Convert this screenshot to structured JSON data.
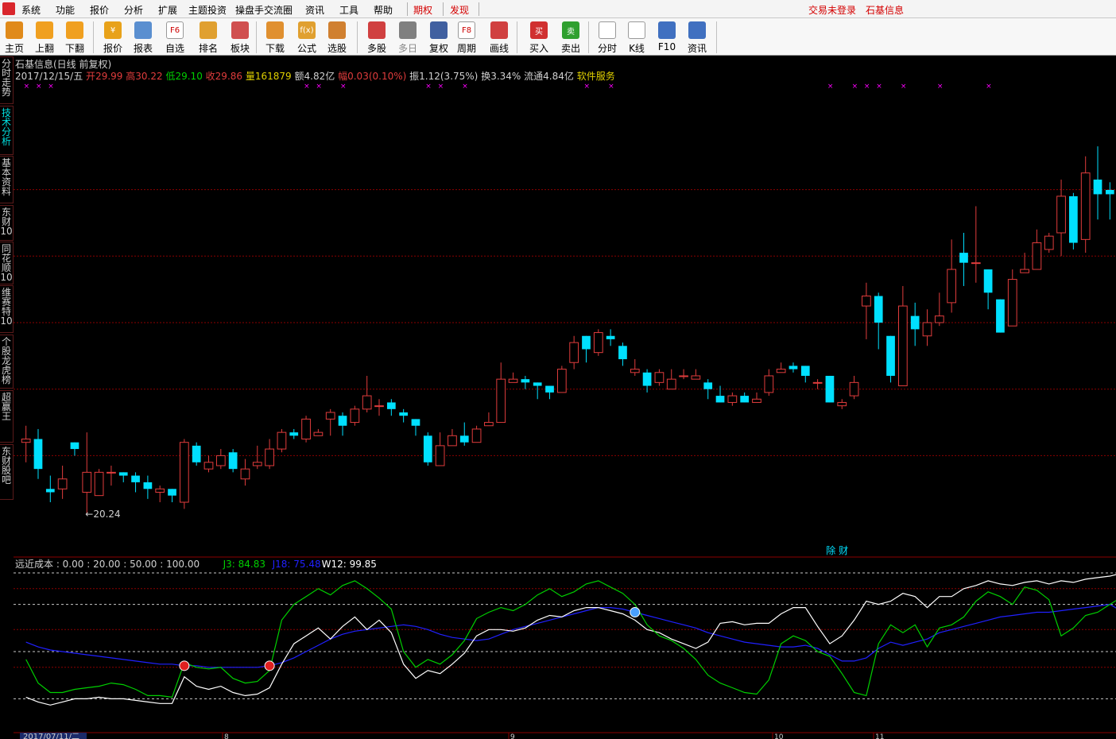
{
  "menubar": {
    "items": [
      "系统",
      "功能",
      "报价",
      "分析",
      "扩展",
      "主题投资",
      "操盘手交流圈",
      "资讯",
      "工具",
      "帮助"
    ],
    "highlight": [
      "期权",
      "发现"
    ],
    "right": [
      "交易未登录",
      "石基信息"
    ]
  },
  "toolbar": {
    "buttons": [
      {
        "label": "主页",
        "icon": "home-icon",
        "color": "#e08a1a"
      },
      {
        "label": "上翻",
        "icon": "arrow-up-icon",
        "color": "#f0a020"
      },
      {
        "label": "下翻",
        "icon": "arrow-down-icon",
        "color": "#f0a020"
      },
      {
        "label": "报价",
        "icon": "yen-icon",
        "color": "#e8a21a",
        "glyph": "¥"
      },
      {
        "label": "报表",
        "icon": "report-icon",
        "color": "#5a8fd0"
      },
      {
        "label": "自选",
        "icon": "f6-icon",
        "color": "#ffffff",
        "glyph": "F6"
      },
      {
        "label": "排名",
        "icon": "ranking-icon",
        "color": "#e0a030"
      },
      {
        "label": "板块",
        "icon": "sector-icon",
        "color": "#d05050"
      },
      {
        "label": "下载",
        "icon": "download-icon",
        "color": "#e09030"
      },
      {
        "label": "公式",
        "icon": "formula-icon",
        "color": "#e0a030",
        "glyph": "f(x)"
      },
      {
        "label": "选股",
        "icon": "stock-select-icon",
        "color": "#d08030"
      },
      {
        "label": "多股",
        "icon": "multi-stock-icon",
        "color": "#d04040"
      },
      {
        "label": "多日",
        "icon": "multi-day-icon",
        "color": "#808080",
        "disabled": true
      },
      {
        "label": "复权",
        "icon": "adjust-icon",
        "color": "#4060a0"
      },
      {
        "label": "周期",
        "icon": "f8-icon",
        "color": "#ffffff",
        "glyph": "F8"
      },
      {
        "label": "画线",
        "icon": "draw-line-icon",
        "color": "#d04040"
      },
      {
        "label": "买入",
        "icon": "buy-icon",
        "color": "#d03030",
        "glyph": "买"
      },
      {
        "label": "卖出",
        "icon": "sell-icon",
        "color": "#30a030",
        "glyph": "卖"
      },
      {
        "label": "分时",
        "icon": "intraday-icon",
        "color": "#ffffff"
      },
      {
        "label": "K线",
        "icon": "kline-icon",
        "color": "#ffffff"
      },
      {
        "label": "F10",
        "icon": "f10-icon",
        "color": "#4070c0"
      },
      {
        "label": "资讯",
        "icon": "news-icon",
        "color": "#4070c0"
      }
    ]
  },
  "sidebar": {
    "tabs": [
      "分时走势",
      "技术分析",
      "基本资料",
      "东财10",
      "同花顺10",
      "维赛特10",
      "个股龙虎榜",
      "超赢王",
      "东财股吧"
    ]
  },
  "header": {
    "title": "石基信息(日线 前复权)",
    "date": "2017/12/15/五",
    "open_label": "开",
    "open": "29.99",
    "high_label": "高",
    "high": "30.22",
    "low_label": "低",
    "low": "29.10",
    "close_label": "收",
    "close": "29.86",
    "vol_label": "量",
    "vol": "161879",
    "amount_label": "额",
    "amount": "4.82亿",
    "chg_label": "幅",
    "chg": "0.03(0.10%)",
    "amp_label": "振",
    "amp": "1.12(3.75%)",
    "turn_label": "换",
    "turn": "3.34%",
    "float_label": "流通",
    "float": "4.84亿",
    "service": "软件服务"
  },
  "chart_data": [
    {
      "type": "candlestick",
      "title": "石基信息(日线 前复权)",
      "start_date": "2017/07/11",
      "ylim": [
        19.0,
        33.0
      ],
      "min_label": "20.24",
      "min_index": 5,
      "event_marker": "除 财",
      "event_index": 67,
      "x_mark_indices": [
        0,
        1,
        2,
        23,
        24,
        26,
        33,
        34,
        36,
        46,
        48,
        66,
        68,
        69,
        70,
        72,
        75,
        79
      ],
      "candles": [
        [
          22.4,
          22.5,
          21.8,
          22.9
        ],
        [
          22.5,
          21.6,
          21.3,
          22.8
        ],
        [
          21.0,
          20.9,
          20.6,
          21.4
        ],
        [
          21.0,
          21.3,
          20.7,
          21.7
        ],
        [
          22.4,
          22.2,
          22.0,
          22.4
        ],
        [
          20.9,
          21.5,
          20.24,
          22.7
        ],
        [
          20.8,
          21.5,
          20.8,
          21.6
        ],
        [
          21.5,
          21.5,
          21.1,
          21.7
        ],
        [
          21.5,
          21.4,
          21.2,
          21.5
        ],
        [
          21.4,
          21.2,
          20.9,
          21.5
        ],
        [
          21.2,
          21.0,
          20.7,
          21.4
        ],
        [
          20.9,
          21.0,
          20.6,
          21.1
        ],
        [
          21.0,
          20.8,
          20.6,
          21.0
        ],
        [
          20.6,
          22.4,
          20.4,
          22.5
        ],
        [
          22.3,
          21.8,
          21.7,
          22.4
        ],
        [
          21.6,
          21.8,
          21.5,
          22.0
        ],
        [
          21.7,
          22.0,
          21.6,
          22.2
        ],
        [
          22.1,
          21.6,
          21.5,
          22.2
        ],
        [
          21.3,
          21.6,
          21.1,
          21.9
        ],
        [
          21.7,
          21.8,
          21.6,
          22.3
        ],
        [
          21.7,
          22.2,
          21.6,
          22.5
        ],
        [
          22.2,
          22.7,
          22.1,
          22.8
        ],
        [
          22.7,
          22.6,
          22.5,
          22.8
        ],
        [
          22.5,
          23.1,
          22.4,
          23.2
        ],
        [
          22.6,
          22.7,
          22.6,
          22.8
        ],
        [
          23.1,
          23.3,
          22.6,
          23.4
        ],
        [
          23.2,
          22.9,
          22.6,
          23.3
        ],
        [
          23.0,
          23.4,
          22.9,
          23.5
        ],
        [
          23.4,
          23.8,
          23.3,
          24.4
        ],
        [
          23.5,
          23.5,
          23.2,
          23.7
        ],
        [
          23.6,
          23.4,
          23.2,
          23.7
        ],
        [
          23.3,
          23.2,
          23.0,
          23.4
        ],
        [
          23.1,
          22.9,
          22.6,
          23.1
        ],
        [
          22.6,
          21.8,
          21.7,
          22.7
        ],
        [
          21.7,
          22.3,
          21.7,
          22.7
        ],
        [
          22.3,
          22.6,
          22.4,
          22.8
        ],
        [
          22.6,
          22.4,
          22.3,
          23.0
        ],
        [
          22.4,
          22.8,
          22.6,
          22.9
        ],
        [
          22.9,
          23.0,
          22.9,
          23.3
        ],
        [
          23.0,
          24.3,
          23.0,
          24.8
        ],
        [
          24.2,
          24.3,
          24.3,
          24.5
        ],
        [
          24.3,
          24.2,
          24.0,
          24.4
        ],
        [
          24.2,
          24.1,
          23.7,
          24.2
        ],
        [
          24.1,
          23.9,
          23.7,
          24.1
        ],
        [
          23.9,
          24.6,
          23.9,
          24.7
        ],
        [
          24.8,
          25.4,
          24.6,
          25.6
        ],
        [
          25.6,
          25.2,
          24.8,
          25.6
        ],
        [
          25.1,
          25.7,
          25.0,
          25.8
        ],
        [
          25.6,
          25.5,
          25.3,
          25.8
        ],
        [
          25.3,
          24.9,
          24.7,
          25.4
        ],
        [
          24.5,
          24.6,
          24.4,
          24.9
        ],
        [
          24.5,
          24.1,
          23.9,
          24.6
        ],
        [
          24.2,
          24.5,
          24.1,
          24.6
        ],
        [
          24.0,
          24.3,
          24.2,
          24.6
        ],
        [
          24.4,
          24.4,
          24.3,
          24.6
        ],
        [
          24.3,
          24.4,
          24.3,
          24.6
        ],
        [
          24.2,
          24.0,
          23.7,
          24.3
        ],
        [
          23.8,
          23.6,
          23.6,
          24.1
        ],
        [
          23.6,
          23.8,
          23.5,
          23.9
        ],
        [
          23.8,
          23.6,
          23.6,
          23.9
        ],
        [
          23.6,
          23.7,
          23.6,
          23.9
        ],
        [
          23.9,
          24.4,
          23.8,
          24.6
        ],
        [
          24.5,
          24.6,
          24.5,
          24.8
        ],
        [
          24.7,
          24.6,
          24.5,
          24.8
        ],
        [
          24.7,
          24.4,
          24.2,
          24.7
        ],
        [
          24.2,
          24.2,
          24.0,
          24.3
        ],
        [
          24.4,
          23.6,
          23.6,
          24.4
        ],
        [
          23.5,
          23.6,
          23.4,
          23.7
        ],
        [
          23.8,
          24.2,
          23.7,
          24.4
        ],
        [
          26.5,
          26.8,
          25.5,
          27.2
        ],
        [
          26.8,
          26.0,
          25.2,
          26.9
        ],
        [
          25.6,
          24.4,
          24.2,
          25.6
        ],
        [
          24.1,
          26.5,
          24.1,
          27.1
        ],
        [
          26.2,
          25.8,
          25.3,
          26.6
        ],
        [
          25.6,
          26.0,
          25.3,
          26.4
        ],
        [
          26.0,
          26.2,
          25.9,
          26.9
        ],
        [
          26.6,
          27.6,
          26.3,
          28.5
        ],
        [
          28.1,
          27.8,
          27.1,
          28.7
        ],
        [
          27.8,
          27.8,
          27.2,
          29.5
        ],
        [
          27.6,
          26.9,
          26.4,
          27.6
        ],
        [
          26.7,
          25.7,
          25.7,
          26.7
        ],
        [
          25.9,
          27.3,
          25.9,
          27.6
        ],
        [
          27.5,
          27.6,
          27.5,
          28.1
        ],
        [
          27.6,
          28.4,
          27.6,
          28.8
        ],
        [
          28.2,
          28.6,
          28.1,
          28.7
        ],
        [
          28.7,
          29.8,
          28.0,
          30.3
        ],
        [
          29.8,
          28.4,
          28.2,
          29.9
        ],
        [
          28.5,
          30.5,
          28.1,
          31.0
        ],
        [
          30.3,
          29.86,
          29.1,
          31.3
        ],
        [
          29.99,
          29.86,
          29.1,
          30.22
        ]
      ]
    },
    {
      "type": "line",
      "title": "远近成本",
      "ylim": [
        0,
        100
      ],
      "levels": [
        "0.00",
        "20.00",
        "50.00",
        "100.00"
      ],
      "level_label": "远近成本",
      "series_labels": [
        {
          "name": "J3",
          "value": "84.83",
          "color": "#00d000"
        },
        {
          "name": "J18",
          "value": "75.48",
          "color": "#2020ff"
        },
        {
          "name": "W12",
          "value": "99.85",
          "color": "#ffffff"
        }
      ],
      "signals": [
        {
          "index": 13,
          "type": "buy"
        },
        {
          "index": 20,
          "type": "buy"
        },
        {
          "index": 50,
          "type": "sell"
        }
      ],
      "J3": [
        45,
        30,
        24,
        24,
        26,
        27,
        28,
        30,
        29,
        26,
        22,
        22,
        21,
        43,
        40,
        39,
        40,
        33,
        30,
        31,
        38,
        70,
        80,
        85,
        90,
        86,
        92,
        95,
        90,
        84,
        77,
        50,
        40,
        45,
        42,
        48,
        57,
        71,
        75,
        78,
        76,
        80,
        86,
        90,
        85,
        88,
        93,
        95,
        91,
        87,
        80,
        67,
        60,
        57,
        52,
        45,
        35,
        30,
        27,
        24,
        23,
        32,
        55,
        60,
        57,
        50,
        47,
        36,
        24,
        22,
        55,
        67,
        62,
        67,
        53,
        65,
        67,
        72,
        82,
        88,
        85,
        80,
        91,
        89,
        83,
        60,
        65,
        73,
        75,
        80,
        84.83
      ],
      "J18": [
        56,
        53,
        51,
        50,
        49,
        48,
        47,
        46,
        45,
        44,
        43,
        42,
        42,
        41,
        41,
        40,
        40,
        40,
        40,
        40,
        41,
        43,
        46,
        50,
        54,
        58,
        61,
        63,
        64,
        65,
        66,
        67,
        66,
        64,
        61,
        59,
        58,
        57,
        58,
        61,
        64,
        66,
        68,
        70,
        72,
        74,
        76,
        78,
        78,
        77,
        75,
        73,
        71,
        69,
        67,
        65,
        62,
        60,
        58,
        56,
        55,
        54,
        53,
        53,
        54,
        52,
        48,
        44,
        44,
        46,
        52,
        56,
        54,
        56,
        58,
        62,
        64,
        66,
        68,
        70,
        72,
        73,
        74,
        75,
        75,
        76,
        77,
        78,
        79,
        80,
        75.48
      ],
      "W12": [
        21,
        18,
        16,
        18,
        20,
        20,
        21,
        20,
        20,
        19,
        18,
        17,
        17,
        34,
        28,
        26,
        28,
        24,
        22,
        23,
        27,
        42,
        55,
        60,
        65,
        58,
        66,
        72,
        64,
        70,
        62,
        42,
        33,
        38,
        36,
        42,
        49,
        60,
        64,
        64,
        63,
        65,
        70,
        73,
        72,
        76,
        78,
        78,
        76,
        74,
        70,
        64,
        62,
        58,
        55,
        52,
        56,
        68,
        69,
        67,
        68,
        68,
        74,
        78,
        78,
        66,
        55,
        60,
        70,
        82,
        80,
        82,
        87,
        85,
        78,
        85,
        85,
        90,
        92,
        95,
        93,
        92,
        94,
        95,
        93,
        95,
        94,
        96,
        97,
        98,
        99.85
      ]
    }
  ],
  "colors": {
    "up": "#e03c3c",
    "down": "#00e0ff",
    "grid": "#8b0000",
    "J3": "#00d000",
    "J18": "#2020ff",
    "W12": "#ffffff",
    "x_mark": "#ff00ff"
  },
  "footer": {
    "date_label": "2017/07/11/二",
    "month_ticks": [
      "8",
      "9",
      "10",
      "11"
    ]
  }
}
